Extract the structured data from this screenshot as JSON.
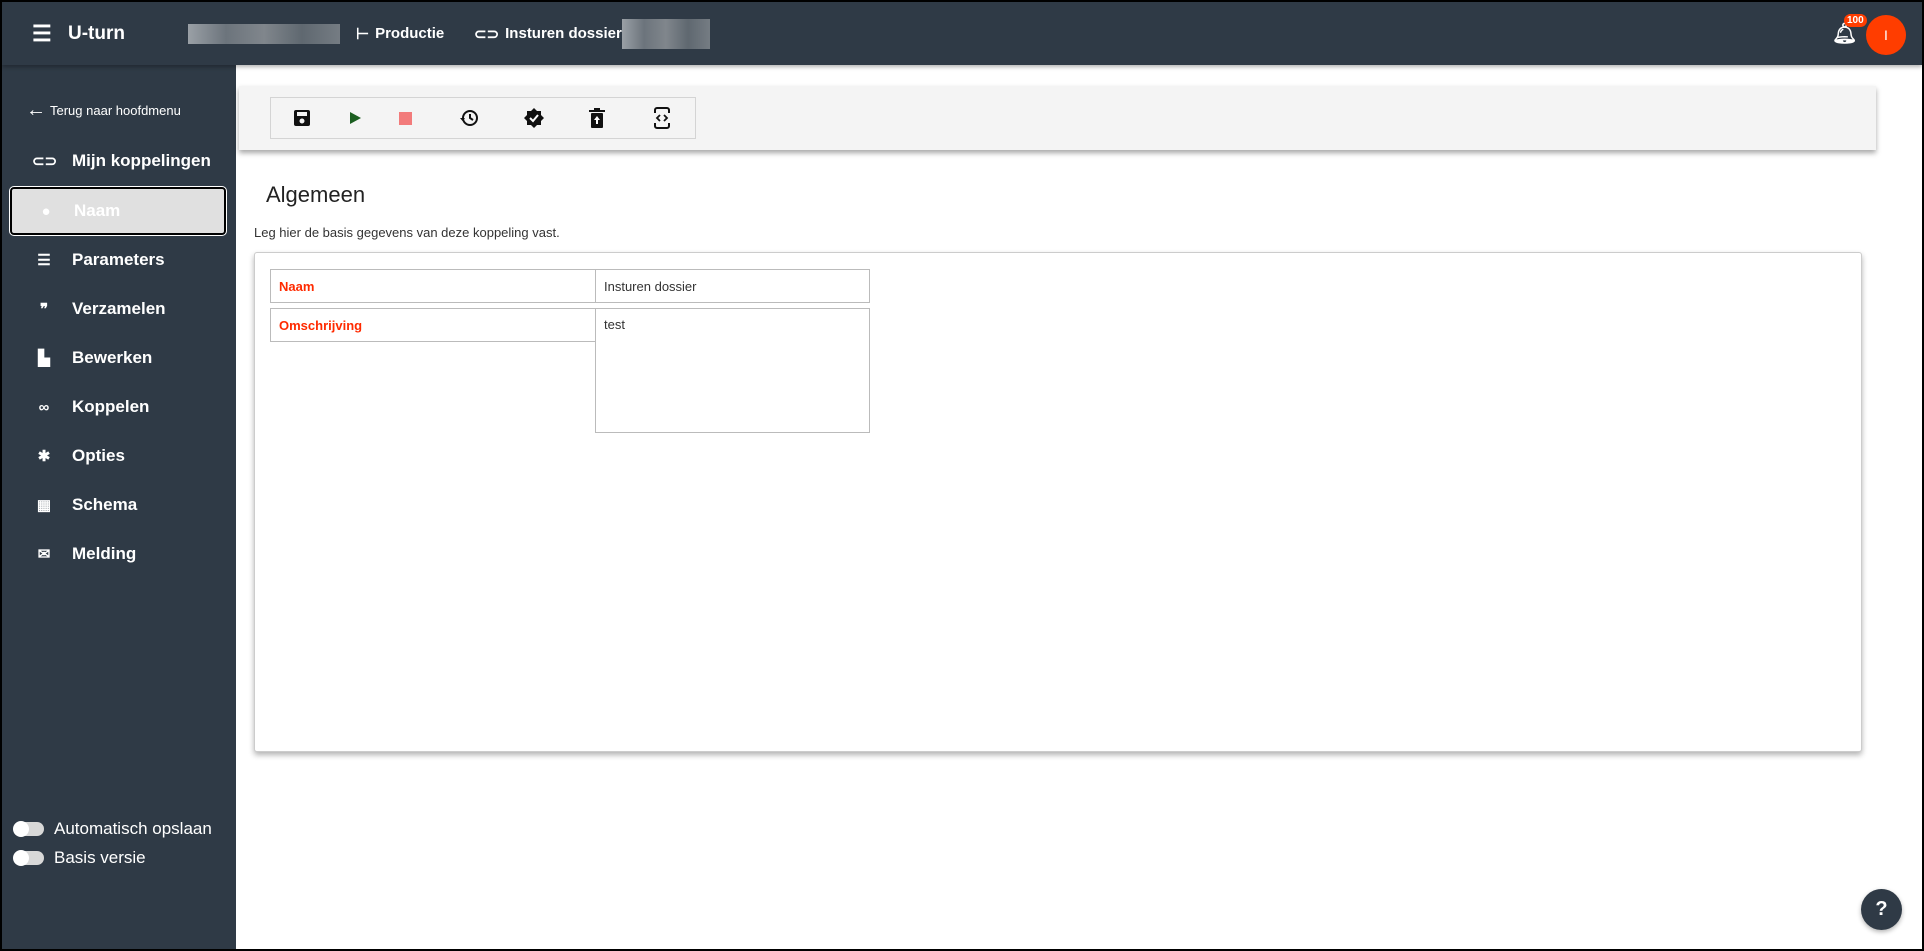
{
  "header": {
    "app_title": "U-turn",
    "environment": "Productie",
    "integration": "Insturen dossier",
    "notification_count": "100",
    "avatar_initial": "I",
    "accent": "#ff3d00"
  },
  "sidebar": {
    "back_label": "Terug naar hoofdmenu",
    "my_links": "Mijn koppelingen",
    "items": [
      {
        "label": "Naam",
        "icon": "person-icon",
        "active": true
      },
      {
        "label": "Parameters",
        "icon": "sliders-icon"
      },
      {
        "label": "Verzamelen",
        "icon": "quote-icon"
      },
      {
        "label": "Bewerken",
        "icon": "bar-chart-icon"
      },
      {
        "label": "Koppelen",
        "icon": "link-icon"
      },
      {
        "label": "Opties",
        "icon": "gear-icon"
      },
      {
        "label": "Schema",
        "icon": "table-icon"
      },
      {
        "label": "Melding",
        "icon": "envelope-icon"
      }
    ],
    "toggles": [
      {
        "label": "Automatisch opslaan",
        "on": false
      },
      {
        "label": "Basis versie",
        "on": false
      }
    ]
  },
  "toolbar": [
    "save-icon",
    "play-icon",
    "stop-icon",
    "history-icon",
    "verified-icon",
    "restore-from-trash-icon",
    "code-icon"
  ],
  "main": {
    "title": "Algemeen",
    "subtitle": "Leg hier de basis gegevens van deze koppeling vast.",
    "fields": [
      {
        "label": "Naam",
        "value": "Insturen dossier"
      },
      {
        "label": "Omschrijving",
        "value": "test"
      }
    ]
  },
  "help": "?"
}
